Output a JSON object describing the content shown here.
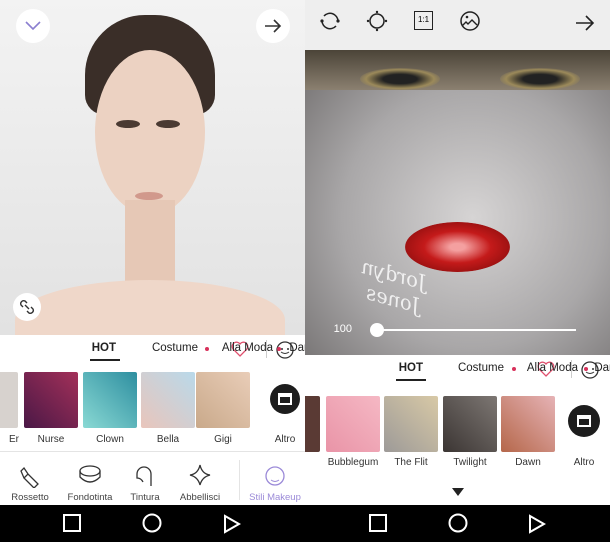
{
  "editor": {
    "toolbar_icons": [
      "arrow-right-icon",
      "image-icon",
      "aspect-1-1-icon",
      "brightness-icon",
      "rotate-icon"
    ],
    "aspect_label": "1:1",
    "signature": "Jordyn Jones",
    "slider_value": "100",
    "slider_percent": 100,
    "tabs": [
      "HOT",
      "Costume",
      "Alla Moda",
      "Dani"
    ],
    "looks": [
      {
        "label": "Altro"
      },
      {
        "label": "Dawn"
      },
      {
        "label": "Twilight"
      },
      {
        "label": "The Flit"
      },
      {
        "label": "Bubblegum"
      }
    ]
  },
  "makeup": {
    "tabs": [
      "HOT",
      "Costume",
      "Alla Moda",
      "Dani"
    ],
    "looks": [
      {
        "label": "Altro"
      },
      {
        "label": "Gigi"
      },
      {
        "label": "Bella"
      },
      {
        "label": "Clown"
      },
      {
        "label": "Nurse"
      },
      {
        "label": "Er"
      }
    ],
    "tools": [
      {
        "label": "Stili Makeup",
        "selected": true
      },
      {
        "label": "Abbellisci"
      },
      {
        "label": "Tintura"
      },
      {
        "label": "Fondotinta"
      },
      {
        "label": "Rossetto"
      }
    ]
  },
  "colors": {
    "accent": "#9b8ad8",
    "dot": "#d8315b",
    "heart": "#e0506e"
  }
}
